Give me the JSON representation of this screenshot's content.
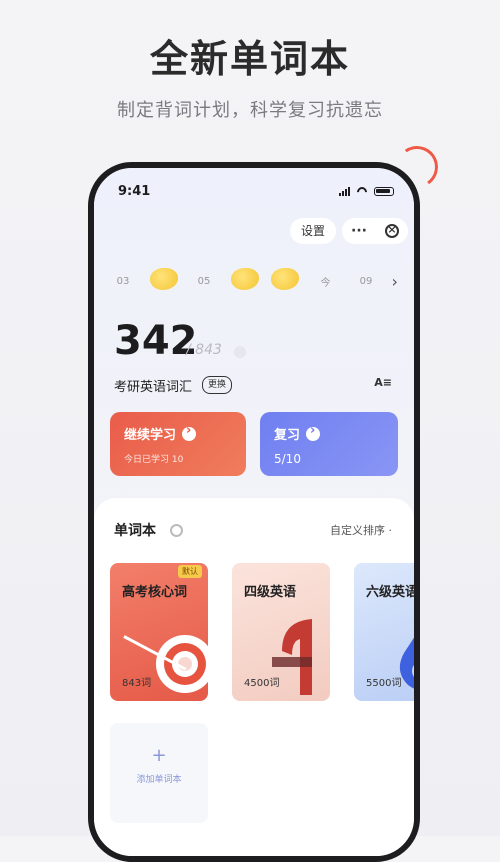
{
  "hero": {
    "title": "全新单词本",
    "subtitle": "制定背词计划，科学复习抗遗忘"
  },
  "status_bar": {
    "time": "9:41"
  },
  "header": {
    "settings_label": "设置",
    "more_label": "···"
  },
  "week": {
    "days": [
      {
        "label": "03",
        "done": false
      },
      {
        "label": "",
        "done": true
      },
      {
        "label": "05",
        "done": false
      },
      {
        "label": "",
        "done": true
      },
      {
        "label": "",
        "done": true
      },
      {
        "label": "今",
        "done": false
      },
      {
        "label": "09",
        "done": false
      }
    ]
  },
  "progress": {
    "learned": "342",
    "total": "/ 843",
    "book_name": "考研英语词汇",
    "change_label": "更换",
    "font_icon_label": "A≡"
  },
  "actions": {
    "continue": {
      "label": "继续学习",
      "sub": "今日已学习 10"
    },
    "review": {
      "label": "复习",
      "sub": "5/10"
    }
  },
  "wordbooks": {
    "title": "单词本",
    "sort_label": "自定义排序 ·",
    "books": [
      {
        "name": "高考核心词",
        "count": "843词",
        "badge": "默认"
      },
      {
        "name": "四级英语",
        "count": "4500词"
      },
      {
        "name": "六级英语",
        "count": "5500词"
      }
    ],
    "add_label": "添加单词本"
  },
  "colors": {
    "accent_red": "#e95c4a",
    "accent_blue": "#6f7ff0",
    "badge_yellow": "#f6c94b"
  }
}
